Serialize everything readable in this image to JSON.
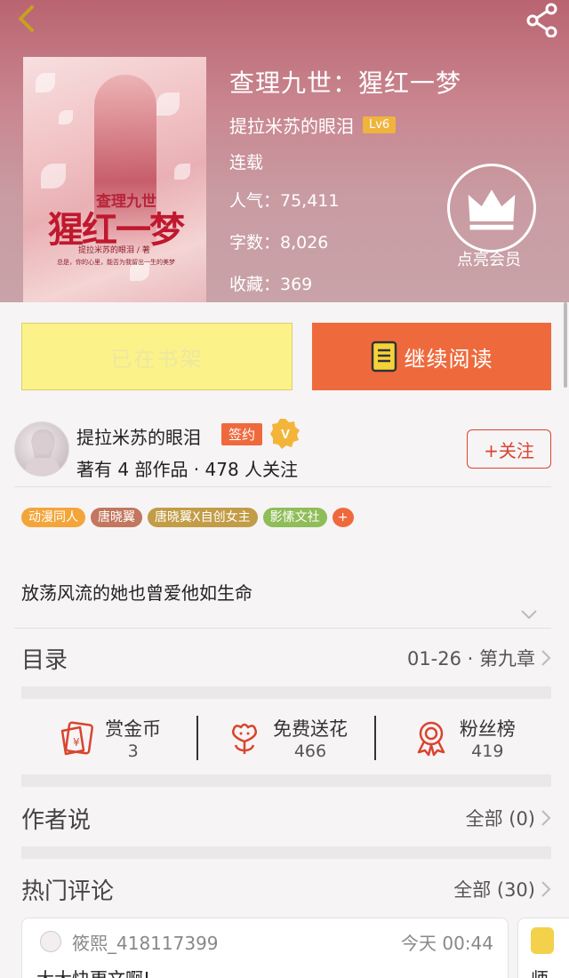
{
  "book": {
    "title": "查理九世：猩红一梦",
    "author": "提拉米苏的眼泪",
    "author_level": "Lv6",
    "status": "连载",
    "popularity": "人气：75,411",
    "word_count": "字数：8,026",
    "favorites": "收藏：369",
    "vip_label": "点亮会员",
    "cover": {
      "title_top": "查理九世",
      "title_main": "猩红一梦",
      "author_line": "提拉米苏的眼泪 / 著",
      "tagline": "总是，你的心里，能否为我留出一生的美梦"
    }
  },
  "actions": {
    "shelf_label": "已在书架",
    "read_label": "继续阅读"
  },
  "author": {
    "name": "提拉米苏的眼泪",
    "signed_badge": "签约",
    "v_badge": "V",
    "stats": "著有 4 部作品 · 478 人关注",
    "follow_label": "+关注"
  },
  "tags": [
    {
      "label": "动漫同人",
      "color": "#f3a53a"
    },
    {
      "label": "唐晓翼",
      "color": "#c2775e"
    },
    {
      "label": "唐晓翼X自创女主",
      "color": "#c29c46"
    },
    {
      "label": "影愫文社",
      "color": "#8fbd58"
    },
    {
      "label": "+",
      "color": "#ee6a3d"
    }
  ],
  "summary": "放荡风流的她也曾爱他如生命",
  "catalog": {
    "label": "目录",
    "latest": "01-26 · 第九章"
  },
  "rewards": [
    {
      "label": "赏金币",
      "count": "3",
      "icon": "red-packet-icon"
    },
    {
      "label": "免费送花",
      "count": "466",
      "icon": "flower-icon"
    },
    {
      "label": "粉丝榜",
      "count": "419",
      "icon": "medal-icon"
    }
  ],
  "author_says": {
    "label": "作者说",
    "all": "全部 (0)"
  },
  "hot_comments": {
    "label": "热门评论",
    "all": "全部 (30)"
  },
  "comments": [
    {
      "user": "筱熙_418117399",
      "time": "今天 00:44",
      "text": "大大快更文啊!"
    },
    {
      "user": "",
      "time": "",
      "text": "师"
    }
  ],
  "colors": {
    "accent": "#ee6a3d",
    "shelf": "#fbf38a",
    "follow": "#d8452f",
    "lv": "#f0b43c"
  }
}
